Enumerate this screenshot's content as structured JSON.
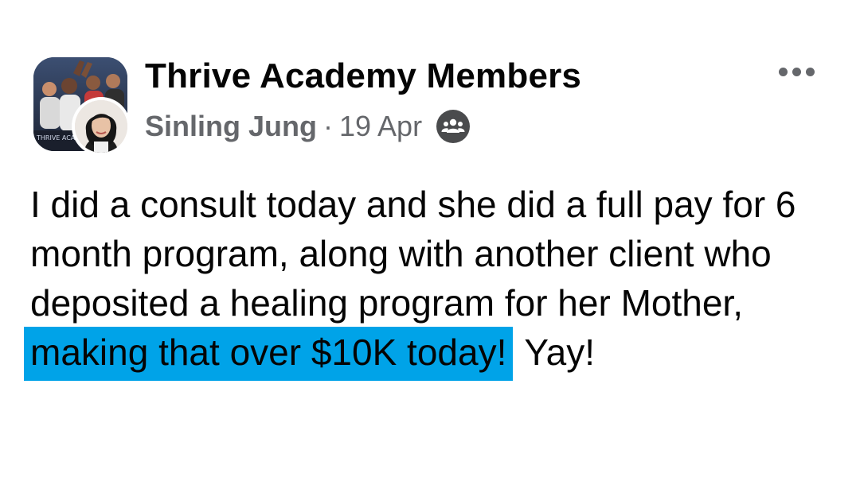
{
  "post": {
    "group_name": "Thrive Academy Members",
    "author": "Sinling Jung",
    "separator": "·",
    "date": "19 Apr",
    "privacy_icon": "group-members-icon",
    "more_icon": "more-options-icon",
    "body_lines": [
      "I did a consult today and she did a full pay for 6",
      "month program, along with another client who",
      "deposited a healing program for her Mother,"
    ],
    "highlighted_text": "making that over $10K today!",
    "tail_text": "Yay!",
    "highlight_color": "#00a3e8",
    "avatar_banner_text": "THRIVE ACA"
  }
}
